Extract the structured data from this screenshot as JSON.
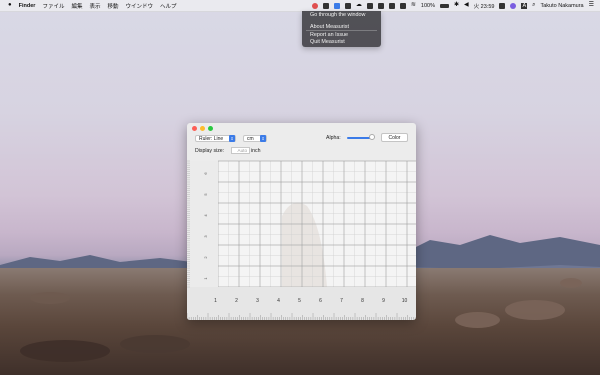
{
  "menubar": {
    "apple": "",
    "items": [
      "Finder",
      "ファイル",
      "編集",
      "表示",
      "移動",
      "ウインドウ",
      "ヘルプ"
    ],
    "battery": "100%",
    "datetime": "火 23:59",
    "user": "Takuto Nakamura",
    "input_source": "A"
  },
  "dropdown": {
    "items": [
      "Go through the window",
      "About Measurist",
      "Report an Issue",
      "Quit Measurist"
    ]
  },
  "window": {
    "ruler_type": "Ruler: Line",
    "unit": "cm",
    "alpha_label": "Alpha:",
    "alpha_value": 0.9,
    "color_button": "Color",
    "display_size_label": "Display size:",
    "display_size_placeholder": "Auto",
    "display_size_unit": "inch"
  },
  "ruler": {
    "x_ticks": [
      "1",
      "2",
      "3",
      "4",
      "5",
      "6",
      "7",
      "8",
      "9",
      "10"
    ],
    "y_ticks": [
      "1",
      "2",
      "3",
      "4",
      "5",
      "6",
      "7"
    ]
  },
  "colors": {
    "accent": "#3b7be8",
    "close": "#fd5f57",
    "minimize": "#fdbc2e",
    "zoom": "#2ac840"
  }
}
